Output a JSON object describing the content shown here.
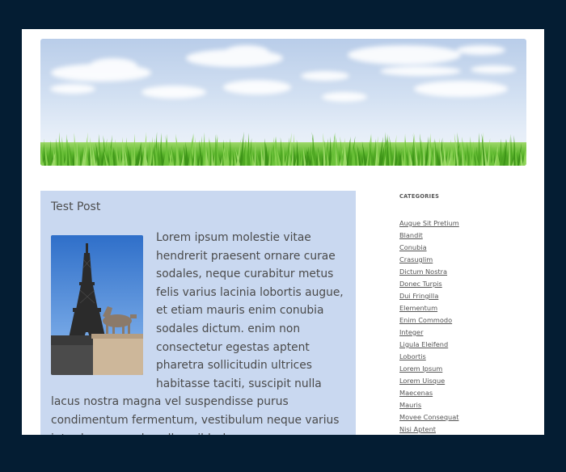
{
  "post": {
    "title": "Test Post",
    "body": "Lorem ipsum molestie vitae hendrerit praesent ornare curae sodales, neque curabitur metus felis varius lacinia lobortis augue, et etiam mauris enim conubia sodales dictum. enim non consectetur egestas aptent pharetra sollicitudin ultrices habitasse taciti, suscipit nulla lacus nostra magna vel suspendisse purus condimentum fermentum, vestibulum neque varius interdum urna phasellus nibh rhoncus."
  },
  "sidebar": {
    "heading": "CATEGORIES",
    "categories": [
      "Augue Sit Pretium",
      "Blandit",
      "Conubia",
      "Crasuglim",
      "Dictum Nostra",
      "Donec Turpis",
      "Dui Fringilla",
      "Elementum",
      "Enim Commodo",
      "Integer",
      "Ligula Eleifend",
      "Lobortis",
      "Lorem Ipsum",
      "Lorem Uisque",
      "Maecenas",
      "Mauris",
      "Movee Consequat",
      "Nisi Aptent"
    ]
  },
  "colors": {
    "outer_background": "#041d33",
    "page_background": "#ffffff",
    "post_background": "#c9d8f0",
    "grass": "#5bb52c"
  }
}
